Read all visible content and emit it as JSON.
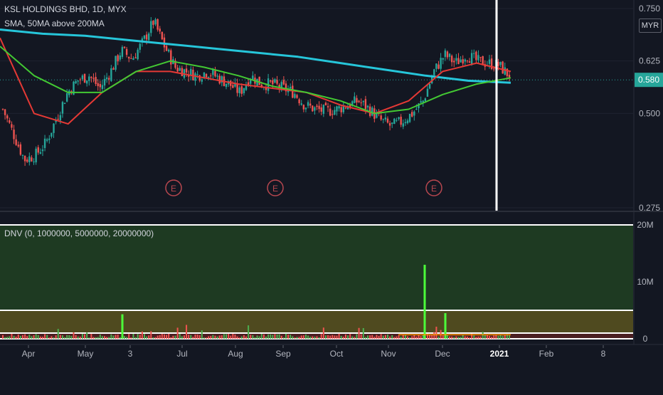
{
  "header": {
    "symbol_title": "KSL HOLDINGS BHD, 1D, MYX",
    "indicator_1": "SMA, 50MA above 200MA",
    "indicator_2": "DNV (0, 1000000, 5000000, 20000000)",
    "currency_button": "MYR"
  },
  "colors": {
    "background": "#131722",
    "up": "#26a69a",
    "down": "#ef5350",
    "ma200": "#26c6da",
    "ma_red": "#e53935",
    "ma_green": "#43c933",
    "earnings": "#b7474f",
    "cursor": "#ffffff",
    "vol_band_top": "#1e3a22",
    "vol_band_mid": "#4f4a1f",
    "vol_band_low": "#4a1f22"
  },
  "chart_data": [
    {
      "type": "candlestick",
      "title": "KSL HOLDINGS BHD, 1D, MYX",
      "ylim": [
        0.275,
        0.75
      ],
      "y_ticks": [
        0.75,
        0.625,
        0.5,
        0.275
      ],
      "last_price": 0.58,
      "last_price_label": "0.580",
      "x_ticks": [
        "Apr",
        "May",
        "3",
        "Jul",
        "Aug",
        "Sep",
        "Oct",
        "Nov",
        "Dec",
        "2021",
        "Feb",
        "8"
      ],
      "earnings_markers": [
        {
          "label": "E",
          "month": "Jun"
        },
        {
          "label": "E",
          "month": "Aug"
        },
        {
          "label": "E",
          "month": "Nov"
        }
      ],
      "price_path": [
        [
          0,
          0.51
        ],
        [
          1,
          0.45
        ],
        [
          2,
          0.39
        ],
        [
          3,
          0.4
        ],
        [
          4,
          0.43
        ],
        [
          5,
          0.49
        ],
        [
          6,
          0.55
        ],
        [
          7,
          0.58
        ],
        [
          8,
          0.59
        ],
        [
          9,
          0.56
        ],
        [
          10,
          0.6
        ],
        [
          11,
          0.65
        ],
        [
          12,
          0.63
        ],
        [
          13,
          0.67
        ],
        [
          14,
          0.72
        ],
        [
          15,
          0.66
        ],
        [
          16,
          0.61
        ],
        [
          17,
          0.6
        ],
        [
          18,
          0.59
        ],
        [
          19,
          0.6
        ],
        [
          20,
          0.585
        ],
        [
          21,
          0.57
        ],
        [
          22,
          0.55
        ],
        [
          23,
          0.59
        ],
        [
          24,
          0.57
        ],
        [
          25,
          0.57
        ],
        [
          26,
          0.56
        ],
        [
          27,
          0.55
        ],
        [
          28,
          0.52
        ],
        [
          29,
          0.51
        ],
        [
          30,
          0.505
        ],
        [
          31,
          0.51
        ],
        [
          32,
          0.52
        ],
        [
          33,
          0.53
        ],
        [
          34,
          0.51
        ],
        [
          35,
          0.485
        ],
        [
          36,
          0.47
        ],
        [
          37,
          0.48
        ],
        [
          38,
          0.5
        ],
        [
          39,
          0.53
        ],
        [
          40,
          0.6
        ],
        [
          41,
          0.64
        ],
        [
          42,
          0.62
        ],
        [
          43,
          0.64
        ],
        [
          44,
          0.625
        ],
        [
          45,
          0.62
        ],
        [
          46,
          0.615
        ],
        [
          47,
          0.59
        ]
      ],
      "series": [
        {
          "name": "200MA",
          "values": [
            0.7,
            0.69,
            0.685,
            0.675,
            0.665,
            0.655,
            0.645,
            0.635,
            0.62,
            0.605,
            0.59,
            0.578,
            0.573
          ]
        },
        {
          "name": "MA",
          "values": [
            0.68,
            0.5,
            0.475,
            0.55,
            0.6,
            0.6,
            0.585,
            0.57,
            0.56,
            0.55,
            0.52,
            0.5,
            0.53,
            0.6,
            0.62,
            0.6
          ]
        },
        {
          "name": "50MA",
          "values": [
            0.66,
            0.59,
            0.55,
            0.55,
            0.6,
            0.625,
            0.61,
            0.59,
            0.565,
            0.55,
            0.53,
            0.5,
            0.51,
            0.545,
            0.57,
            0.585
          ]
        }
      ]
    },
    {
      "type": "bar",
      "title": "DNV (0, 1000000, 5000000, 20000000)",
      "ylim": [
        0,
        20000000
      ],
      "y_ticks": [
        "20M",
        "10M",
        "0"
      ],
      "bands": [
        0,
        1000000,
        5000000,
        20000000
      ],
      "notable_values": [
        {
          "x": "Nov",
          "value": 13000000
        },
        {
          "x": "May",
          "value": 4300000
        },
        {
          "x": "Dec",
          "value": 4500000
        }
      ]
    }
  ]
}
